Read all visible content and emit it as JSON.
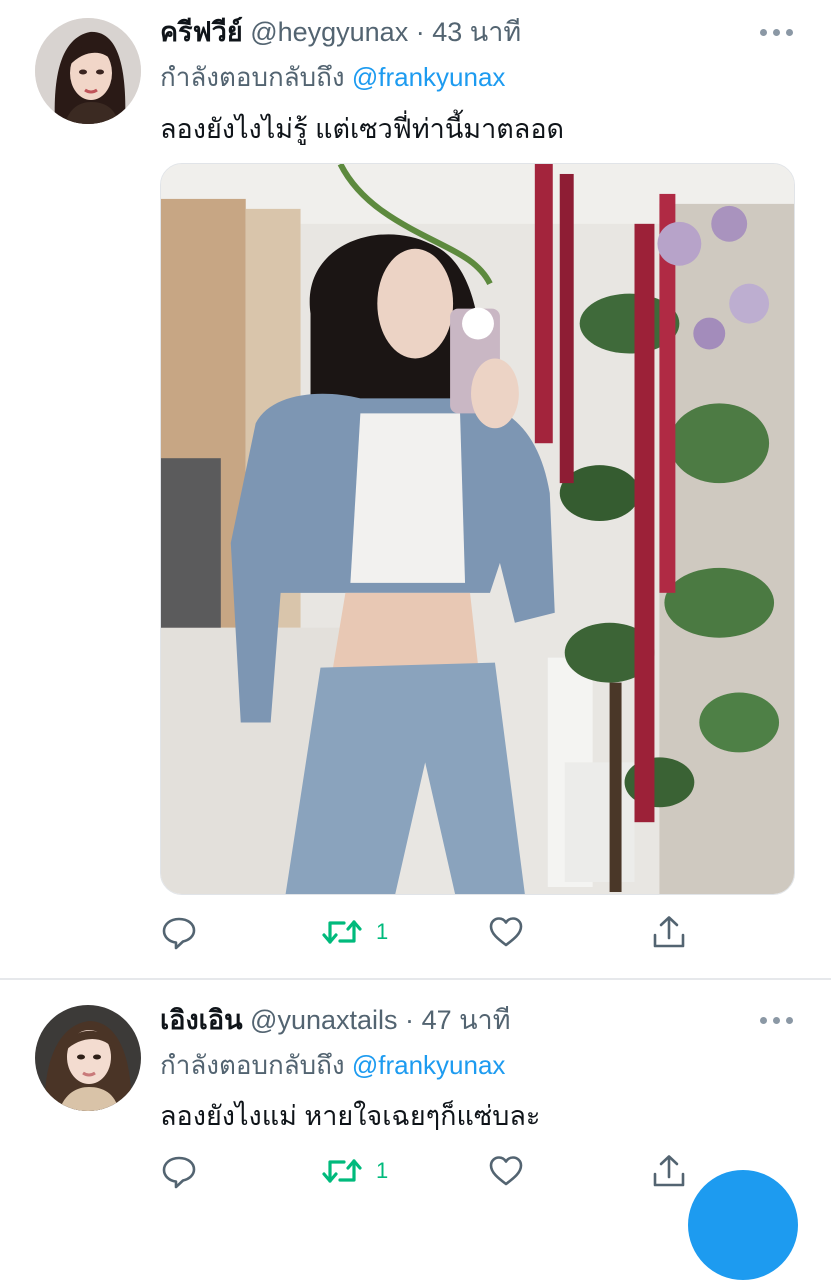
{
  "tweets": [
    {
      "display_name": "ครีฟวีย์",
      "handle": "@heygyunax",
      "separator": "·",
      "time": "43 นาที",
      "reply_prefix": "กำลังตอบกลับถึง",
      "reply_to": "@frankyunax",
      "text": "ลองยังไงไม่รู้ แต่เซวฟี่ท่านี้มาตลอด",
      "retweet_count": "1",
      "has_media": true
    },
    {
      "display_name": "เอิงเอิน",
      "handle": "@yunaxtails",
      "separator": "·",
      "time": "47 นาที",
      "reply_prefix": "กำลังตอบกลับถึง",
      "reply_to": "@frankyunax",
      "text": "ลองยังไงแม่ หายใจเฉยๆก็แซ่บละ",
      "retweet_count": "1",
      "has_media": false
    }
  ],
  "icons": {
    "reply": "reply-icon",
    "retweet": "retweet-icon",
    "like": "heart-icon",
    "share": "share-icon",
    "more": "more-icon",
    "compose": "compose-icon"
  },
  "colors": {
    "text_primary": "#0f1419",
    "text_secondary": "#536471",
    "mention": "#1d9bf0",
    "retweet_active": "#00ba7c",
    "icon": "#536471",
    "fab": "#1d9bf0"
  }
}
